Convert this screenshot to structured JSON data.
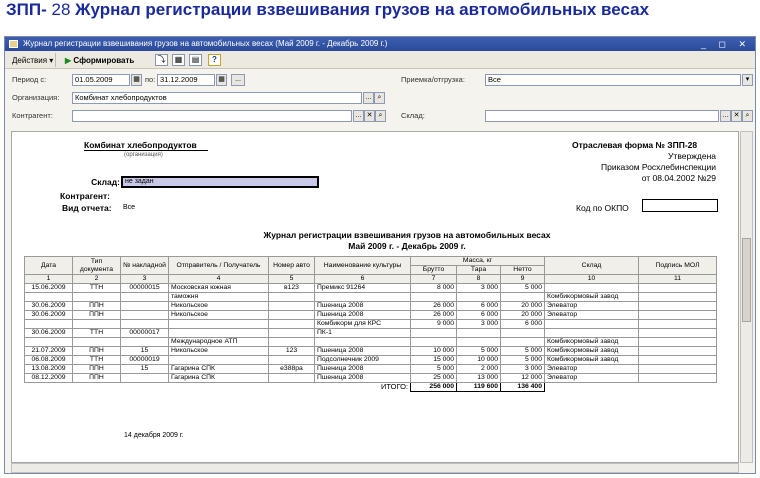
{
  "slide": {
    "prefix": "ЗПП-",
    "number": "28",
    "title": "Журнал регистрации взвешивания грузов на автомобильных весах"
  },
  "window": {
    "title": "Журнал регистрации взвешивания грузов на автомобильных весах (Май 2009 г. - Декабрь 2009 г.)",
    "controls": "_ ◻ ✕"
  },
  "toolbar": {
    "actions": "Действия",
    "generate": "Сформировать"
  },
  "filters": {
    "period_label": "Период с:",
    "period_from": "01.05.2009",
    "period_to_label": "по:",
    "period_to": "31.12.2009",
    "org_label": "Организация:",
    "org_value": "Комбинат хлебопродуктов",
    "contractor_label": "Контрагент:",
    "contractor_value": "",
    "receipt_label": "Приемка/отгрузка:",
    "receipt_value": "Все",
    "warehouse_label": "Склад:",
    "warehouse_value": ""
  },
  "report": {
    "org_name": "Комбинат хлебопродуктов",
    "org_caption": "(организация)",
    "form_name": "Отраслевая форма № ЗПП-28",
    "approved": "Утверждена",
    "order": "Приказом Росхлебинспекции",
    "order_date": "от 08.04.2002 №29",
    "warehouse_label": "Склад:",
    "warehouse_value": "не задан",
    "contractor_label": "Контрагент:",
    "view_label": "Вид отчета:",
    "view_value": "Все",
    "okpo_label": "Код по ОКПО",
    "title_line1": "Журнал регистрации взвешивания грузов на автомобильных весах",
    "title_line2": "Май 2009 г. - Декабрь 2009 г.",
    "headers": {
      "date": "Дата",
      "doc_type": "Тип документа",
      "invoice": "№ накладной",
      "sender": "Отправитель / Получатель",
      "car": "Номер авто",
      "crop": "Наименование культуры",
      "mass": "Масса, кг",
      "gross": "Брутто",
      "tare": "Тара",
      "net": "Нетто",
      "warehouse": "Склад",
      "signature": "Подпись МОЛ"
    },
    "col_numbers": [
      "1",
      "2",
      "3",
      "4",
      "5",
      "6",
      "7",
      "8",
      "9",
      "10",
      "11"
    ],
    "rows": [
      {
        "date": "15.06.2009",
        "type": "ТТН",
        "inv": "00000015",
        "sender": "Московская южная",
        "car": "в123",
        "crop": "Премикс 91264",
        "gross": "8 000",
        "tare": "3 000",
        "net": "5 000",
        "wh": ""
      },
      {
        "date": "",
        "type": "",
        "inv": "",
        "sender": "таможня",
        "car": "",
        "crop": "",
        "gross": "",
        "tare": "",
        "net": "",
        "wh": "Комбикормовый завод"
      },
      {
        "date": "30.06.2009",
        "type": "ППН",
        "inv": "",
        "sender": "Никольское",
        "car": "",
        "crop": "Пшеница 2008",
        "gross": "26 000",
        "tare": "6 000",
        "net": "20 000",
        "wh": "Элеватор"
      },
      {
        "date": "30.06.2009",
        "type": "ППН",
        "inv": "",
        "sender": "Никольское",
        "car": "",
        "crop": "Пшеница 2008",
        "gross": "26 000",
        "tare": "6 000",
        "net": "20 000",
        "wh": "Элеватор"
      },
      {
        "date": "",
        "type": "",
        "inv": "",
        "sender": "",
        "car": "",
        "crop": "Комбикорм для КРС",
        "gross": "9 000",
        "tare": "3 000",
        "net": "6 000",
        "wh": ""
      },
      {
        "date": "30.06.2009",
        "type": "ТТН",
        "inv": "00000017",
        "sender": "",
        "car": "",
        "crop": "ПК-1",
        "gross": "",
        "tare": "",
        "net": "",
        "wh": ""
      },
      {
        "date": "",
        "type": "",
        "inv": "",
        "sender": "Международное АТП",
        "car": "",
        "crop": "",
        "gross": "",
        "tare": "",
        "net": "",
        "wh": "Комбикормовый завод"
      },
      {
        "date": "21.07.2009",
        "type": "ППН",
        "inv": "15",
        "sender": "Никольское",
        "car": "123",
        "crop": "Пшеница 2008",
        "gross": "10 000",
        "tare": "5 000",
        "net": "5 000",
        "wh": "Комбикормовый завод"
      },
      {
        "date": "06.08.2009",
        "type": "ТТН",
        "inv": "00000019",
        "sender": "",
        "car": "",
        "crop": "Подсолнечник 2009",
        "gross": "15 000",
        "tare": "10 000",
        "net": "5 000",
        "wh": "Комбикормовый завод"
      },
      {
        "date": "13.08.2009",
        "type": "ППН",
        "inv": "15",
        "sender": "Гагарина СПК",
        "car": "е388ра",
        "crop": "Пшеница 2008",
        "gross": "5 000",
        "tare": "2 000",
        "net": "3 000",
        "wh": "Элеватор"
      },
      {
        "date": "08.12.2009",
        "type": "ППН",
        "inv": "",
        "sender": "Гагарина СПК",
        "car": "",
        "crop": "Пшеница 2008",
        "gross": "25 000",
        "tare": "13 000",
        "net": "12 000",
        "wh": "Элеватор"
      }
    ],
    "total_label": "ИТОГО:",
    "total_gross": "256 000",
    "total_tare": "119 600",
    "total_net": "136 400",
    "sign_date": "14 декабря 2009 г."
  }
}
